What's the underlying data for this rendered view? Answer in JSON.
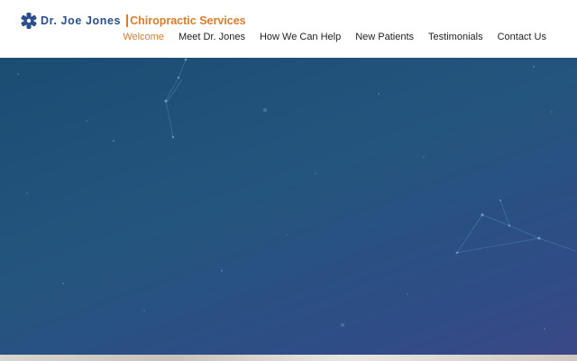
{
  "logo": {
    "icon": "medical-star-icon",
    "name": "Dr. Joe Jones",
    "tagline": "Chiropractic Services"
  },
  "nav": {
    "items": [
      {
        "label": "Welcome",
        "active": true
      },
      {
        "label": "Meet Dr. Jones",
        "active": false
      },
      {
        "label": "How We Can Help",
        "active": false
      },
      {
        "label": "New Patients",
        "active": false
      },
      {
        "label": "Testimonials",
        "active": false
      },
      {
        "label": "Contact Us",
        "active": false
      }
    ]
  },
  "colors": {
    "brand_blue": "#2a4f8a",
    "accent_orange": "#e07b2a",
    "hero_blue": "#24557e"
  }
}
